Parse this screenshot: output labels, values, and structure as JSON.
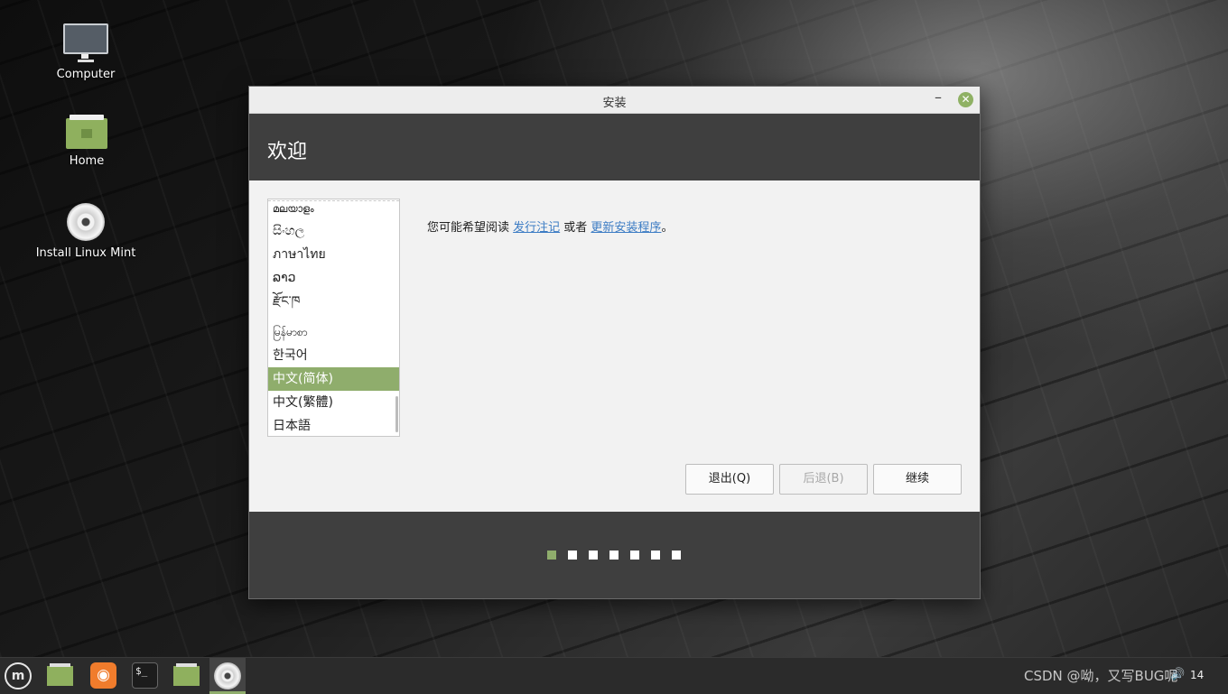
{
  "desktop": {
    "icons": [
      {
        "label": "Computer",
        "icon": "computer-icon"
      },
      {
        "label": "Home",
        "icon": "folder-home-icon"
      },
      {
        "label": "Install Linux Mint",
        "icon": "disc-icon"
      }
    ]
  },
  "window": {
    "title": "安装",
    "minimize_glyph": "–",
    "close_glyph": "✕",
    "header_title": "欢迎",
    "languages": [
      "മലയാളം",
      "සිංහල",
      "ภาษาไทย",
      "ລາວ",
      "རྫོང་ཁ",
      "မြန်မာစာ",
      "한국어",
      "中文(简体)",
      "中文(繁體)",
      "日本語"
    ],
    "selected_language": "中文(简体)",
    "info": {
      "prefix": "您可能希望阅读 ",
      "link1": "发行注记",
      "middle": " 或者 ",
      "link2": "更新安装程序",
      "suffix": "。"
    },
    "buttons": {
      "quit": "退出(Q)",
      "back": "后退(B)",
      "continue": "继续"
    },
    "progress": {
      "total_steps": 7,
      "current_step": 1
    }
  },
  "taskbar": {
    "apps": [
      "menu-icon",
      "files-icon",
      "firefox-icon",
      "terminal-icon",
      "files-icon",
      "installer-disc-icon"
    ],
    "terminal_glyph": "$_",
    "clock": "14",
    "volume_glyph": "🔊"
  },
  "watermark": "CSDN @呦，又写BUG呢",
  "colors": {
    "accent": "#8fad6c",
    "header": "#3f3f3f",
    "link": "#3c7cc4"
  }
}
